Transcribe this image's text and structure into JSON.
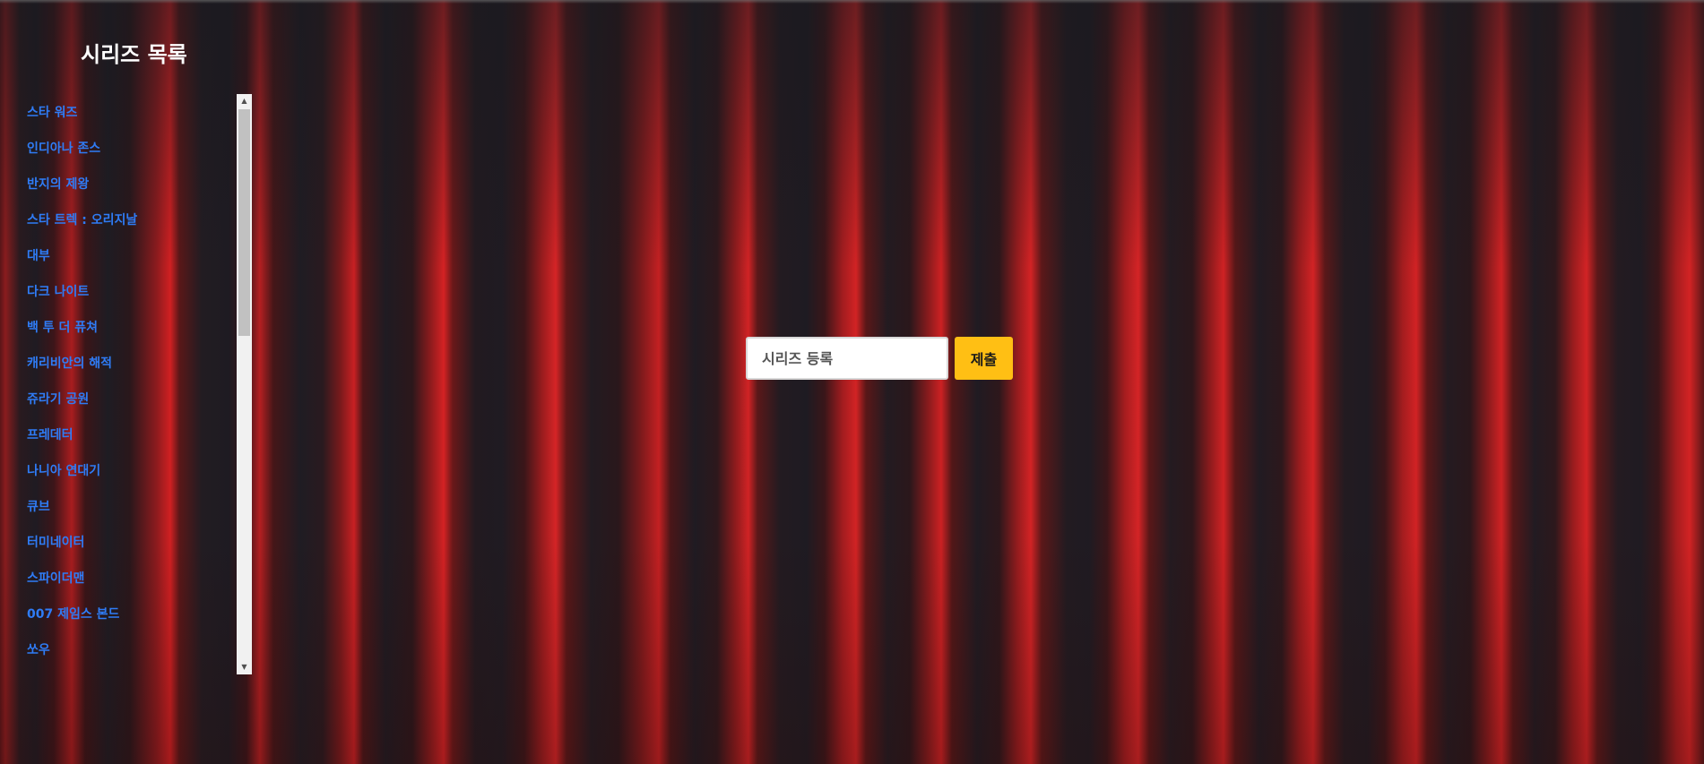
{
  "sidebar": {
    "title": "시리즈 목록",
    "items": [
      {
        "label": "스타 워즈"
      },
      {
        "label": "인디아나 존스"
      },
      {
        "label": "반지의 제왕"
      },
      {
        "label": "스타 트렉 : 오리지날"
      },
      {
        "label": "대부"
      },
      {
        "label": "다크 나이트"
      },
      {
        "label": "백 투 더 퓨쳐"
      },
      {
        "label": "캐리비안의 해적"
      },
      {
        "label": "쥬라기 공원"
      },
      {
        "label": "프레데터"
      },
      {
        "label": "나니아 연대기"
      },
      {
        "label": "큐브"
      },
      {
        "label": "터미네이터"
      },
      {
        "label": "스파이더맨"
      },
      {
        "label": "007 제임스 본드"
      },
      {
        "label": "쏘우"
      }
    ],
    "scrollbar": {
      "up_icon": "▲",
      "down_icon": "▼"
    }
  },
  "form": {
    "input_placeholder": "시리즈 등록",
    "input_value": "",
    "submit_label": "제출"
  },
  "colors": {
    "link": "#2f7cf6",
    "title": "#ffffff",
    "submit_bg": "#ffbf14",
    "curtain": "#b01c1e"
  }
}
